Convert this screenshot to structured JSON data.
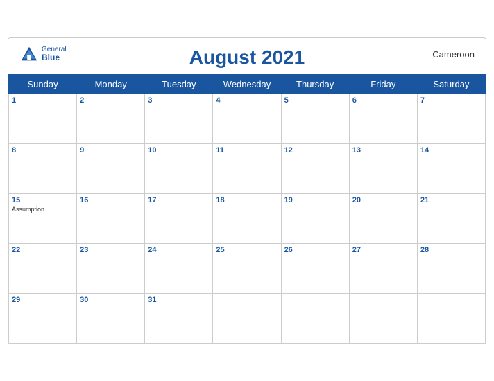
{
  "header": {
    "title": "August 2021",
    "country": "Cameroon",
    "logo_general": "General",
    "logo_blue": "Blue"
  },
  "weekdays": [
    "Sunday",
    "Monday",
    "Tuesday",
    "Wednesday",
    "Thursday",
    "Friday",
    "Saturday"
  ],
  "weeks": [
    [
      {
        "day": "1",
        "events": []
      },
      {
        "day": "2",
        "events": []
      },
      {
        "day": "3",
        "events": []
      },
      {
        "day": "4",
        "events": []
      },
      {
        "day": "5",
        "events": []
      },
      {
        "day": "6",
        "events": []
      },
      {
        "day": "7",
        "events": []
      }
    ],
    [
      {
        "day": "8",
        "events": []
      },
      {
        "day": "9",
        "events": []
      },
      {
        "day": "10",
        "events": []
      },
      {
        "day": "11",
        "events": []
      },
      {
        "day": "12",
        "events": []
      },
      {
        "day": "13",
        "events": []
      },
      {
        "day": "14",
        "events": []
      }
    ],
    [
      {
        "day": "15",
        "events": [
          "Assumption"
        ]
      },
      {
        "day": "16",
        "events": []
      },
      {
        "day": "17",
        "events": []
      },
      {
        "day": "18",
        "events": []
      },
      {
        "day": "19",
        "events": []
      },
      {
        "day": "20",
        "events": []
      },
      {
        "day": "21",
        "events": []
      }
    ],
    [
      {
        "day": "22",
        "events": []
      },
      {
        "day": "23",
        "events": []
      },
      {
        "day": "24",
        "events": []
      },
      {
        "day": "25",
        "events": []
      },
      {
        "day": "26",
        "events": []
      },
      {
        "day": "27",
        "events": []
      },
      {
        "day": "28",
        "events": []
      }
    ],
    [
      {
        "day": "29",
        "events": []
      },
      {
        "day": "30",
        "events": []
      },
      {
        "day": "31",
        "events": []
      },
      {
        "day": "",
        "events": []
      },
      {
        "day": "",
        "events": []
      },
      {
        "day": "",
        "events": []
      },
      {
        "day": "",
        "events": []
      }
    ]
  ]
}
